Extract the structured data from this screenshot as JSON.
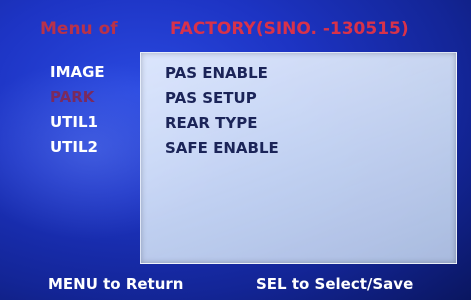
{
  "header": {
    "menu_label": "Menu of",
    "menu_value": "FACTORY(SINO.  -130515)"
  },
  "sidebar": {
    "items": [
      {
        "label": "IMAGE",
        "state": "normal"
      },
      {
        "label": "PARK",
        "state": "dim"
      },
      {
        "label": "UTIL1",
        "state": "normal"
      },
      {
        "label": "UTIL2",
        "state": "normal"
      }
    ]
  },
  "panel": {
    "items": [
      {
        "label": "PAS ENABLE"
      },
      {
        "label": "PAS SETUP"
      },
      {
        "label": "REAR TYPE"
      },
      {
        "label": "SAFE ENABLE"
      }
    ]
  },
  "footer": {
    "left_hint": "MENU to Return",
    "right_hint": "SEL to Select/Save"
  },
  "colors": {
    "background": "#1d34c4",
    "title_text": "#d8324a",
    "menu_text": "#ffffff",
    "dim_text": "#7a2a5e",
    "panel_text": "#1b2458",
    "panel_bg": "#e6f0ff"
  }
}
